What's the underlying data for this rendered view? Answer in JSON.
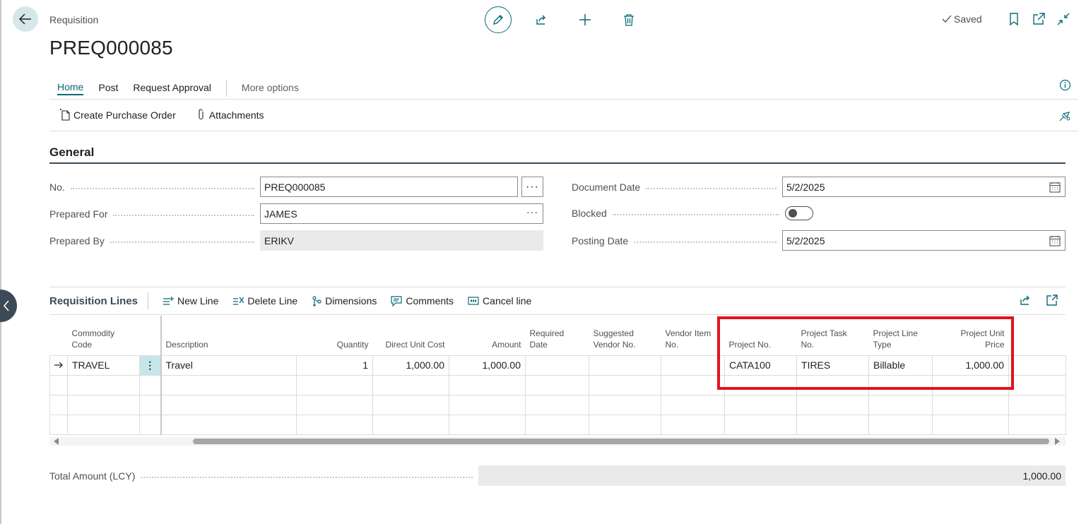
{
  "header": {
    "breadcrumb": "Requisition",
    "title": "PREQ000085",
    "status": "Saved"
  },
  "tabs": [
    {
      "label": "Home",
      "active": true
    },
    {
      "label": "Post"
    },
    {
      "label": "Request Approval"
    },
    {
      "label": "More options"
    }
  ],
  "actions": {
    "create_po": "Create Purchase Order",
    "attachments": "Attachments"
  },
  "general": {
    "title": "General",
    "no_label": "No.",
    "no_value": "PREQ000085",
    "prepared_for_label": "Prepared For",
    "prepared_for_value": "JAMES",
    "prepared_by_label": "Prepared By",
    "prepared_by_value": "ERIKV",
    "document_date_label": "Document Date",
    "document_date_value": "5/2/2025",
    "blocked_label": "Blocked",
    "blocked_value": false,
    "posting_date_label": "Posting Date",
    "posting_date_value": "5/2/2025"
  },
  "lines": {
    "title": "Requisition Lines",
    "actions": {
      "new_line": "New Line",
      "delete_line": "Delete Line",
      "dimensions": "Dimensions",
      "comments": "Comments",
      "cancel_line": "Cancel line"
    },
    "columns": {
      "commodity_code": [
        "Commodity",
        "Code"
      ],
      "description": "Description",
      "quantity": "Quantity",
      "direct_unit_cost": "Direct Unit Cost",
      "amount": "Amount",
      "required_date": [
        "Required",
        "Date"
      ],
      "suggested_vendor": [
        "Suggested",
        "Vendor No."
      ],
      "vendor_item": [
        "Vendor Item",
        "No."
      ],
      "project_no": "Project No.",
      "project_task": [
        "Project Task",
        "No."
      ],
      "project_line_type": [
        "Project Line",
        "Type"
      ],
      "project_unit_price": [
        "Project Unit",
        "Price"
      ]
    },
    "rows": [
      {
        "commodity_code": "TRAVEL",
        "description": "Travel",
        "quantity": "1",
        "direct_unit_cost": "1,000.00",
        "amount": "1,000.00",
        "required_date": "",
        "suggested_vendor": "",
        "vendor_item": "",
        "project_no": "CATA100",
        "project_task": "TIRES",
        "project_line_type": "Billable",
        "project_unit_price": "1,000.00"
      }
    ]
  },
  "total": {
    "label": "Total Amount (LCY)",
    "value": "1,000.00"
  },
  "colors": {
    "accent": "#0b6a78",
    "highlight": "#e0141e",
    "dark_header": "#3c4a57"
  }
}
